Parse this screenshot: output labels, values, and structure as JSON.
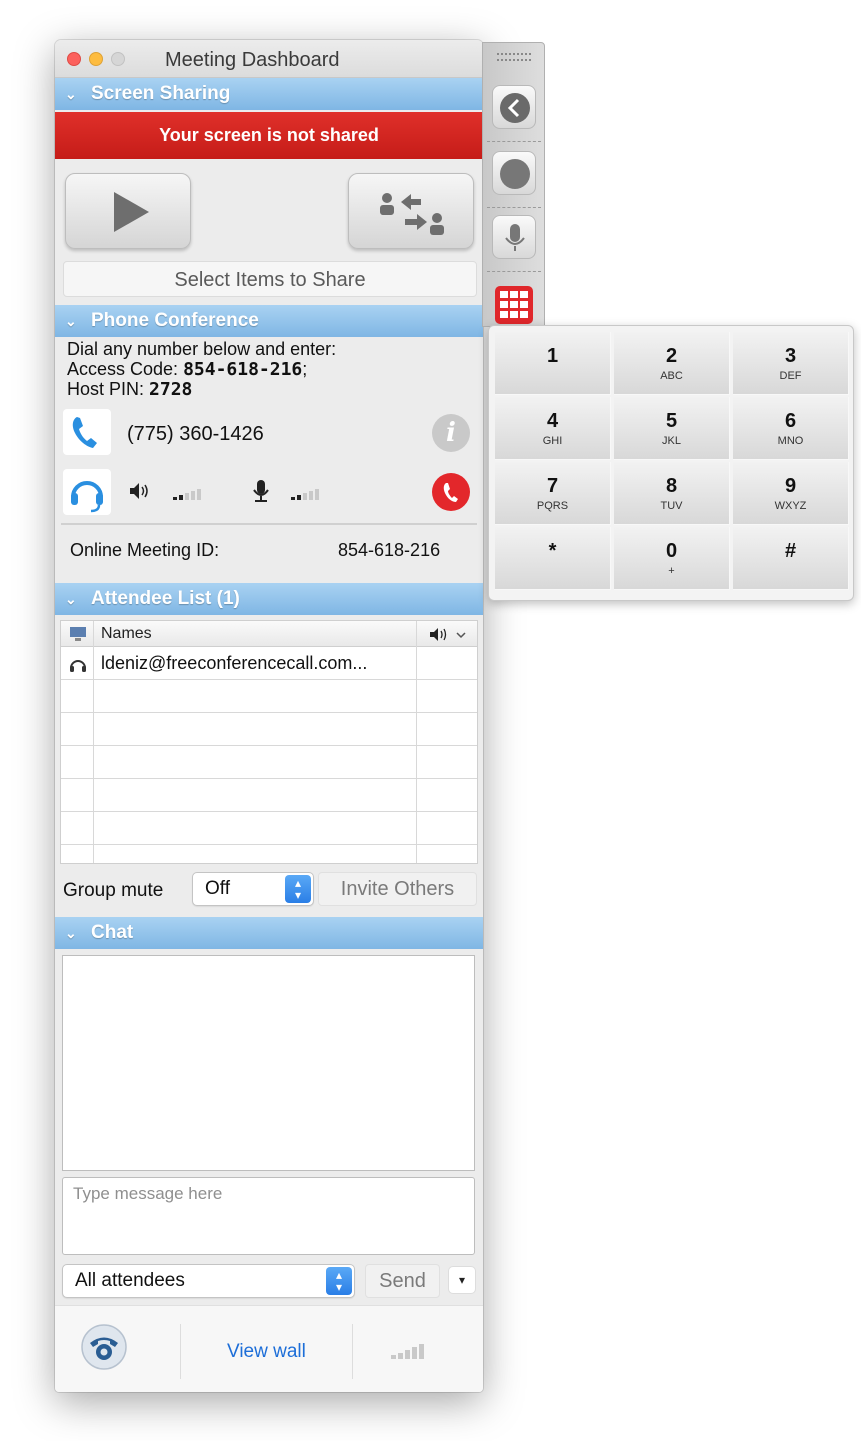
{
  "window": {
    "title": "Meeting Dashboard"
  },
  "screen_sharing": {
    "header": "Screen Sharing",
    "status": "Your screen is not shared",
    "select_items": "Select Items to Share"
  },
  "phone_conference": {
    "header": "Phone Conference",
    "instructions": "Dial any number below and enter:",
    "access_code_label": "Access Code: ",
    "access_code": "854-618-216",
    "access_code_suffix": ";",
    "host_pin_label": "Host PIN: ",
    "host_pin": "2728",
    "phone_number": "(775) 360-1426",
    "online_meeting_id_label": "Online Meeting ID:",
    "online_meeting_id": "854-618-216"
  },
  "attendees": {
    "header": "Attendee List (1)",
    "col_names": "Names",
    "rows": [
      "ldeniz@freeconferencecall.com..."
    ]
  },
  "controls": {
    "group_mute_label": "Group mute",
    "group_mute_value": "Off",
    "invite_others": "Invite Others"
  },
  "chat": {
    "header": "Chat",
    "placeholder": "Type message here",
    "recipient": "All attendees",
    "send": "Send"
  },
  "footer": {
    "view_wall": "View wall"
  },
  "keypad": {
    "keys": [
      {
        "d": "1",
        "l": ""
      },
      {
        "d": "2",
        "l": "ABC"
      },
      {
        "d": "3",
        "l": "DEF"
      },
      {
        "d": "4",
        "l": "GHI"
      },
      {
        "d": "5",
        "l": "JKL"
      },
      {
        "d": "6",
        "l": "MNO"
      },
      {
        "d": "7",
        "l": "PQRS"
      },
      {
        "d": "8",
        "l": "TUV"
      },
      {
        "d": "9",
        "l": "WXYZ"
      },
      {
        "d": "*",
        "l": ""
      },
      {
        "d": "0",
        "l": "+"
      },
      {
        "d": "#",
        "l": ""
      }
    ]
  },
  "colors": {
    "section_header": "#7fb6e4",
    "alert_red": "#d4231e",
    "link_blue": "#1d6ed8",
    "keypad_icon_red": "#e0272b"
  },
  "icons": [
    "play-icon",
    "swap-presenter-icon",
    "phone-icon",
    "headset-icon",
    "speaker-icon",
    "microphone-icon",
    "info-icon",
    "hangup-icon",
    "back-icon",
    "record-icon",
    "keypad-icon",
    "signal-icon"
  ]
}
